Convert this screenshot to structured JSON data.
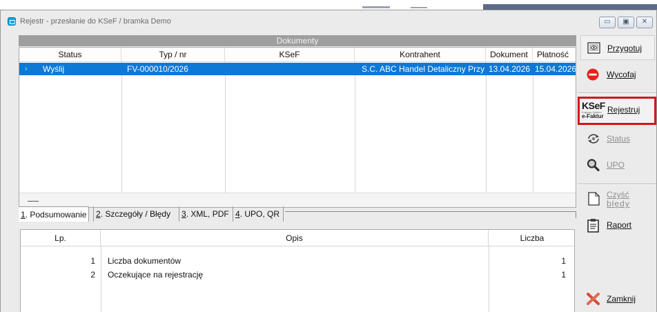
{
  "window": {
    "title": "Rejestr - przesłanie do KSeF / bramka Demo",
    "controls": [
      "minimize",
      "maximize",
      "close"
    ]
  },
  "documents": {
    "header": "Dokumenty",
    "columns": [
      "Status",
      "Typ / nr",
      "KSeF",
      "Kontrahent",
      "Dokument",
      "Płatność"
    ],
    "rows": [
      {
        "status": "Wyślij",
        "typ_nr": "FV-000010/2026",
        "ksef": "",
        "kontrahent": "S.C. ABC Handel Detaliczny Przy",
        "dokument": "13.04.2026",
        "platnosc": "15.04.2026",
        "selected": true
      }
    ],
    "footer_symbol": "—"
  },
  "tabs": [
    {
      "key": "1",
      "label": ". Podsumowanie",
      "active": true
    },
    {
      "key": "2",
      "label": ". Szczegóły / Błędy",
      "active": false
    },
    {
      "key": "3",
      "label": ". XML, PDF",
      "active": false
    },
    {
      "key": "4",
      "label": ". UPO, QR",
      "active": false
    }
  ],
  "summary": {
    "columns": [
      "Lp.",
      "Opis",
      "Liczba"
    ],
    "rows": [
      {
        "lp": "1",
        "opis": "Liczba dokumentów",
        "liczba": "1"
      },
      {
        "lp": "2",
        "opis": "Oczekujące na rejestrację",
        "liczba": "1"
      }
    ]
  },
  "sidebar": {
    "przygotuj": "Przygotuj",
    "wycofaj": "Wycofaj",
    "rejestruj": "Rejestruj",
    "status": "Status",
    "upo": "UPO",
    "czysc_bledy_1": "Czyść",
    "czysc_bledy_2": "błędy",
    "raport": "Raport",
    "zamknij": "Zamknij",
    "ksef_logo_top": "KSeF",
    "ksef_logo_small": "Krajowy System",
    "ksef_logo_bottom": "e-Faktur"
  },
  "colors": {
    "selection": "#0d78d6",
    "highlight_border": "#d5141b",
    "header_bar": "#9e9e9e"
  }
}
